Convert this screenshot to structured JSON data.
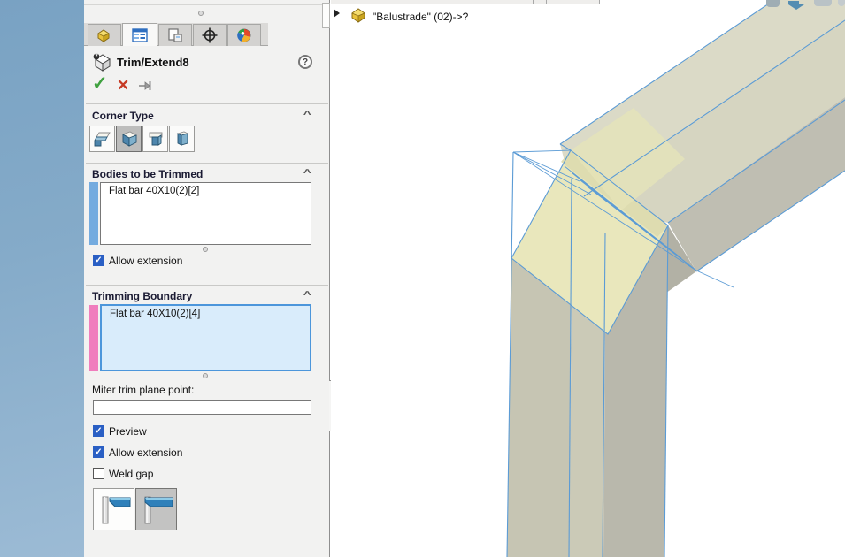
{
  "panel": {
    "tabs": [
      {
        "icon": "part-icon"
      },
      {
        "icon": "property-manager-icon"
      },
      {
        "icon": "configuration-icon"
      },
      {
        "icon": "dimxpert-icon"
      },
      {
        "icon": "display-manager-icon"
      }
    ],
    "active_tab_index": 1,
    "header": {
      "title": "Trim/Extend8",
      "help": "?"
    },
    "actions": {
      "ok": "ok-check-icon",
      "cancel": "cancel-x-icon",
      "pin": "pin-icon"
    },
    "corner_type": {
      "label": "Corner Type",
      "options": [
        "end-trim",
        "end-miter",
        "end-butt1",
        "end-butt2"
      ],
      "selected_index": 1
    },
    "bodies_to_be_trimmed": {
      "label": "Bodies to be Trimmed",
      "items": [
        "Flat bar 40X10(2)[2]"
      ],
      "selection_bar_color": "#74abdf",
      "allow_extension": {
        "label": "Allow extension",
        "checked": true
      }
    },
    "trimming_boundary": {
      "label": "Trimming Boundary",
      "items": [
        "Flat bar 40X10(2)[4]"
      ],
      "selection_bar_color": "#f07dbd",
      "box_fill": "#d9ecfb",
      "box_border": "#4c96db"
    },
    "miter_point": {
      "label": "Miter trim plane point:",
      "value": ""
    },
    "checkboxes": [
      {
        "label": "Preview",
        "checked": true
      },
      {
        "label": "Allow extension",
        "checked": true
      },
      {
        "label": "Weld gap",
        "checked": false
      }
    ],
    "weld_trim_options": {
      "icons": [
        "trim-flag-offset",
        "trim-flag-flush"
      ],
      "selected_index": 1
    }
  },
  "viewport": {
    "flyout_label": "\"Balustrade\" (02)->?",
    "model_edge_color": "#5b9bd5",
    "face_colors": {
      "beige_top": "#dbdac7",
      "beige_mid": "#d6d5c1",
      "gray_shade": "#bfbeb2",
      "miter_highlight": "#e9e7bc"
    }
  }
}
